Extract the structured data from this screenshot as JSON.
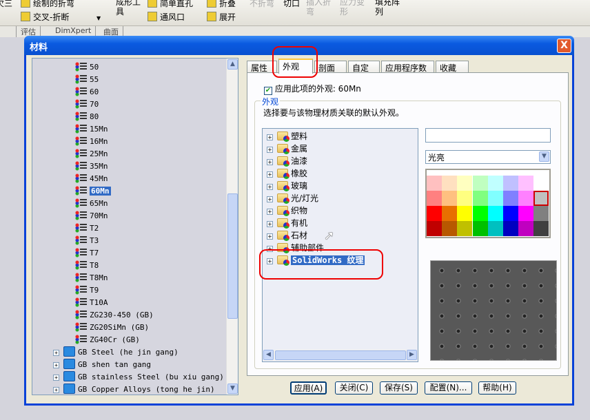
{
  "toolbar": {
    "items": [
      "绘制的折弯",
      "交叉-折断",
      "成形工具",
      "简单直孔",
      "通风口",
      "折叠",
      "展开",
      "不折弯",
      "切口",
      "插入折弯",
      "应力变形",
      "填充阵列",
      "欠三"
    ]
  },
  "cmd_tabs": [
    "评估",
    "DimXpert",
    "曲面"
  ],
  "dialog": {
    "title": "材料",
    "close": "X"
  },
  "material_tree": {
    "items": [
      "50",
      "55",
      "60",
      "70",
      "80",
      "15Mn",
      "16Mn",
      "25Mn",
      "35Mn",
      "45Mn",
      "60Mn",
      "65Mn",
      "70Mn",
      "T2",
      "T3",
      "T7",
      "T8",
      "T8Mn",
      "T9",
      "T10A",
      "ZG230-450 (GB)",
      "ZG20SiMn (GB)",
      "ZG40Cr (GB)"
    ],
    "selected": "60Mn",
    "groups": [
      "GB Steel (he jin gang)",
      "GB shen tan gang",
      "GB stainless Steel (bu xiu gang)",
      "GB Copper Alloys (tong he jin)"
    ]
  },
  "tabs": [
    "属性",
    "外观",
    "剖面线",
    "自定义",
    "应用程序数据",
    "收藏"
  ],
  "active_tab": "外观",
  "appearance": {
    "apply_checkbox": {
      "label": "应用此项的外观: 60Mn",
      "checked": true
    },
    "group_title": "外观",
    "description": "选择要与该物理材质关联的默认外观。",
    "categories": [
      "塑料",
      "金属",
      "油漆",
      "橡胶",
      "玻璃",
      "光/灯光",
      "织物",
      "有机",
      "石材",
      "辅助部件",
      "SolidWorks 纹理"
    ],
    "selected_category": "SolidWorks 纹理",
    "name_field": "",
    "finish_select": "光亮",
    "palette": [
      [
        "#ffc0c0",
        "#ffe0c0",
        "#ffffc0",
        "#c0ffc0",
        "#c0ffff",
        "#c0c0ff",
        "#ffc0ff",
        "#ffffff"
      ],
      [
        "#ff8080",
        "#ffc080",
        "#ffff80",
        "#80ff80",
        "#80ffff",
        "#8080ff",
        "#ff80ff",
        "#c0c0c0"
      ],
      [
        "#ff0000",
        "#e87000",
        "#ffff00",
        "#00ff00",
        "#00ffff",
        "#0000ff",
        "#ff00ff",
        "#808080"
      ],
      [
        "#c00000",
        "#b85800",
        "#c0c000",
        "#00c000",
        "#00c0c0",
        "#0000c0",
        "#c000c0",
        "#404040"
      ]
    ],
    "selected_swatch": "#c0c0c0"
  },
  "buttons": {
    "apply": "应用(A)",
    "close": "关闭(C)",
    "save": "保存(S)",
    "config": "配置(N)...",
    "help": "帮助(H)"
  },
  "colors": {
    "titlebar": "#0a5ae0",
    "selection": "#316ac5",
    "highlight_ring": "#ee0000"
  }
}
